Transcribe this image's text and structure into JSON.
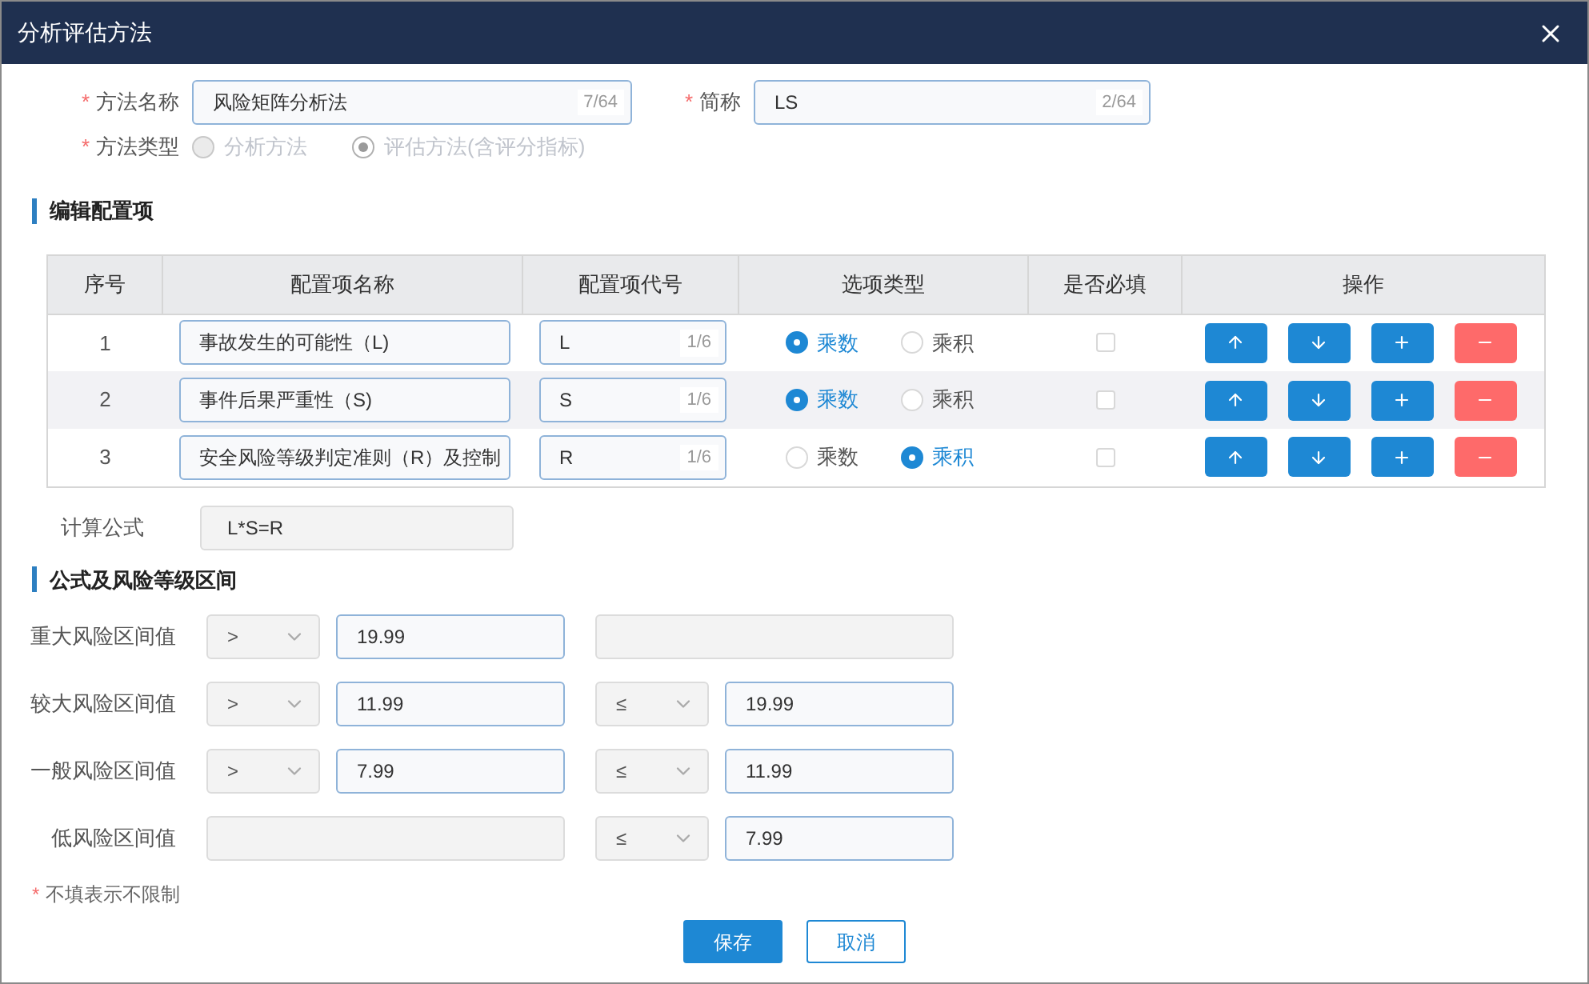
{
  "window": {
    "title": "分析评估方法"
  },
  "method_name": {
    "marker": "*",
    "label": "方法名称",
    "value": "风险矩阵分析法",
    "counter": "7/64"
  },
  "short_name": {
    "marker": "*",
    "label": "简称",
    "value": "LS",
    "counter": "2/64"
  },
  "method_type": {
    "marker": "*",
    "label": "方法类型",
    "options": [
      {
        "label": "分析方法",
        "selected": false,
        "disabled": true
      },
      {
        "label": "评估方法(含评分指标)",
        "selected": true,
        "disabled": true
      }
    ]
  },
  "config_section": {
    "title": "编辑配置项"
  },
  "table": {
    "columns": [
      "序号",
      "配置项名称",
      "配置项代号",
      "选项类型",
      "是否必填",
      "操作"
    ],
    "rows": [
      {
        "index": "1",
        "name": "事故发生的可能性（L)",
        "code": "L",
        "counter": "1/6",
        "options": [
          {
            "label": "乘数",
            "selected": true
          },
          {
            "label": "乘积",
            "selected": false
          }
        ],
        "checked": false
      },
      {
        "index": "2",
        "name": "事件后果严重性（S)",
        "code": "S",
        "counter": "1/6",
        "options": [
          {
            "label": "乘数",
            "selected": true
          },
          {
            "label": "乘积",
            "selected": false
          }
        ],
        "checked": false
      },
      {
        "index": "3",
        "name": "安全风险等级判定准则（R）及控制",
        "code": "R",
        "counter": "1/6",
        "options": [
          {
            "label": "乘数",
            "selected": false
          },
          {
            "label": "乘积",
            "selected": true
          }
        ],
        "checked": false
      }
    ]
  },
  "formula": {
    "label": "计算公式",
    "value": "L*S=R"
  },
  "range_section": {
    "title": "公式及风险等级区间"
  },
  "ranges": [
    {
      "label": "重大风险区间值",
      "lower": {
        "op": ">",
        "value": "19.99"
      }
    },
    {
      "label": "较大风险区间值",
      "lower": {
        "op": ">",
        "value": "11.99"
      },
      "upper": {
        "op": "≤",
        "value": "19.99"
      }
    },
    {
      "label": "一般风险区间值",
      "lower": {
        "op": ">",
        "value": "7.99"
      },
      "upper": {
        "op": "≤",
        "value": "11.99"
      }
    },
    {
      "label": "低风险区间值",
      "upper": {
        "op": "≤",
        "value": "7.99"
      }
    }
  ],
  "note": {
    "marker": "*",
    "text": "不填表示不限制"
  },
  "buttons": [
    {
      "label": "保存",
      "kind": "primary"
    },
    {
      "label": "取消",
      "kind": "secondary"
    }
  ]
}
